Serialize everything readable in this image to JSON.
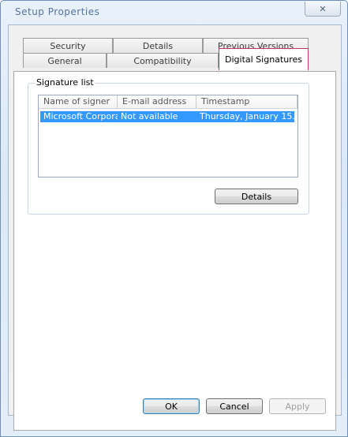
{
  "window": {
    "title": "Setup Properties",
    "close_label": "✕"
  },
  "tabs": [
    {
      "label": "Security",
      "active": false
    },
    {
      "label": "Details",
      "active": false
    },
    {
      "label": "Previous Versions",
      "active": false
    },
    {
      "label": "General",
      "active": false
    },
    {
      "label": "Compatibility",
      "active": false
    },
    {
      "label": "Digital Signatures",
      "active": true
    }
  ],
  "signature_list": {
    "group_label": "Signature list",
    "columns": [
      "Name of signer",
      "E-mail address",
      "Timestamp"
    ],
    "rows": [
      {
        "name": "Microsoft Corpora...",
        "email": "Not available",
        "timestamp": "Thursday, January 15..."
      }
    ],
    "details_button": "Details"
  },
  "footer": {
    "ok": "OK",
    "cancel": "Cancel",
    "apply": "Apply"
  }
}
